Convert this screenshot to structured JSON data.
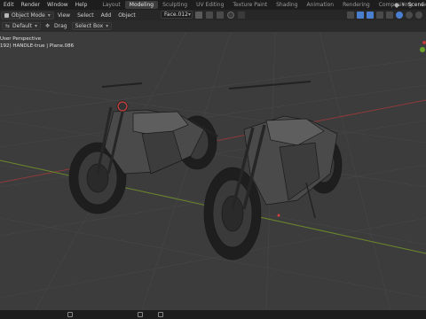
{
  "menu": [
    "Edit",
    "Render",
    "Window",
    "Help"
  ],
  "workspace_tabs": [
    {
      "label": "Layout",
      "active": false
    },
    {
      "label": "Modeling",
      "active": true
    },
    {
      "label": "Sculpting",
      "active": false
    },
    {
      "label": "UV Editing",
      "active": false
    },
    {
      "label": "Texture Paint",
      "active": false
    },
    {
      "label": "Shading",
      "active": false
    },
    {
      "label": "Animation",
      "active": false
    },
    {
      "label": "Rendering",
      "active": false
    },
    {
      "label": "Compositing",
      "active": false
    },
    {
      "label": "Geomet",
      "active": false
    }
  ],
  "scene": {
    "label": "Scene"
  },
  "header": {
    "mode": "Object Mode",
    "items": [
      "View",
      "Select",
      "Add",
      "Object"
    ],
    "face_set": "Face.012"
  },
  "tool_settings": {
    "orientation": "Default",
    "drag_label": "Drag",
    "select_box": "Select Box"
  },
  "viewport": {
    "perspective": "User Perspective",
    "object_info": "192) HANDLE-true | Plane.086"
  },
  "colors": {
    "topbar": "#1d1d1d",
    "viewport_bg": "#3c3c3c",
    "grid": "#4a4a4a",
    "axis_x": "#9a3a3a",
    "axis_y": "#6a8a2a",
    "active_tab": "#3d3d3d",
    "accent": "#4a7fcf"
  },
  "icons": [
    "dropdown-arrow",
    "mode-icon",
    "move-icon",
    "drag-icon",
    "select-box-icon",
    "snap-icon",
    "proportional-icon",
    "overlay-icon",
    "shading-solid-icon",
    "scene-icon",
    "gizmo-icon"
  ]
}
